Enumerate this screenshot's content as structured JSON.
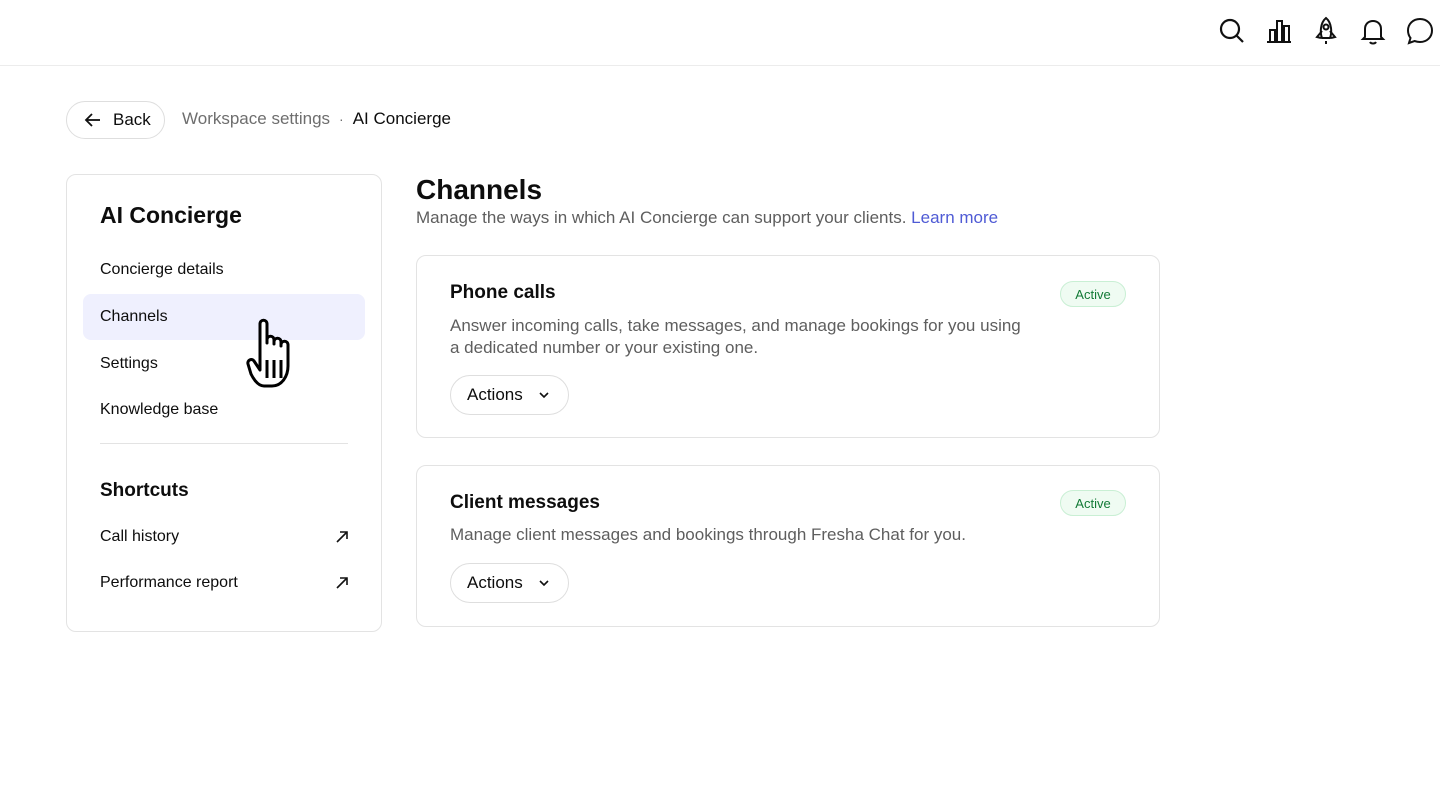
{
  "topbar": {
    "icons": [
      "search-icon",
      "bar-chart-icon",
      "rocket-icon",
      "bell-icon",
      "chat-icon"
    ]
  },
  "back_button": {
    "label": "Back"
  },
  "breadcrumb": {
    "parent": "Workspace settings",
    "separator": "·",
    "current": "AI Concierge"
  },
  "sidebar": {
    "title": "AI Concierge",
    "items": [
      {
        "label": "Concierge details",
        "active": false
      },
      {
        "label": "Channels",
        "active": true
      },
      {
        "label": "Settings",
        "active": false
      },
      {
        "label": "Knowledge base",
        "active": false
      }
    ],
    "shortcuts_title": "Shortcuts",
    "shortcuts": [
      {
        "label": "Call history",
        "icon": "external-link-icon"
      },
      {
        "label": "Performance report",
        "icon": "external-link-icon"
      }
    ]
  },
  "main": {
    "title": "Channels",
    "subtitle": "Manage the ways in which AI Concierge can support your clients.",
    "learn_more": "Learn more",
    "cards": [
      {
        "title": "Phone calls",
        "status": "Active",
        "description": "Answer incoming calls, take messages, and manage bookings for you using a dedicated number or your existing one.",
        "actions_label": "Actions"
      },
      {
        "title": "Client messages",
        "status": "Active",
        "description": "Manage client messages and bookings through Fresha Chat for you.",
        "actions_label": "Actions"
      }
    ]
  },
  "colors": {
    "accent_link": "#4f5bd5",
    "active_nav_bg": "#eff0fe",
    "badge_bg": "#effbf2",
    "badge_text": "#127a36"
  }
}
